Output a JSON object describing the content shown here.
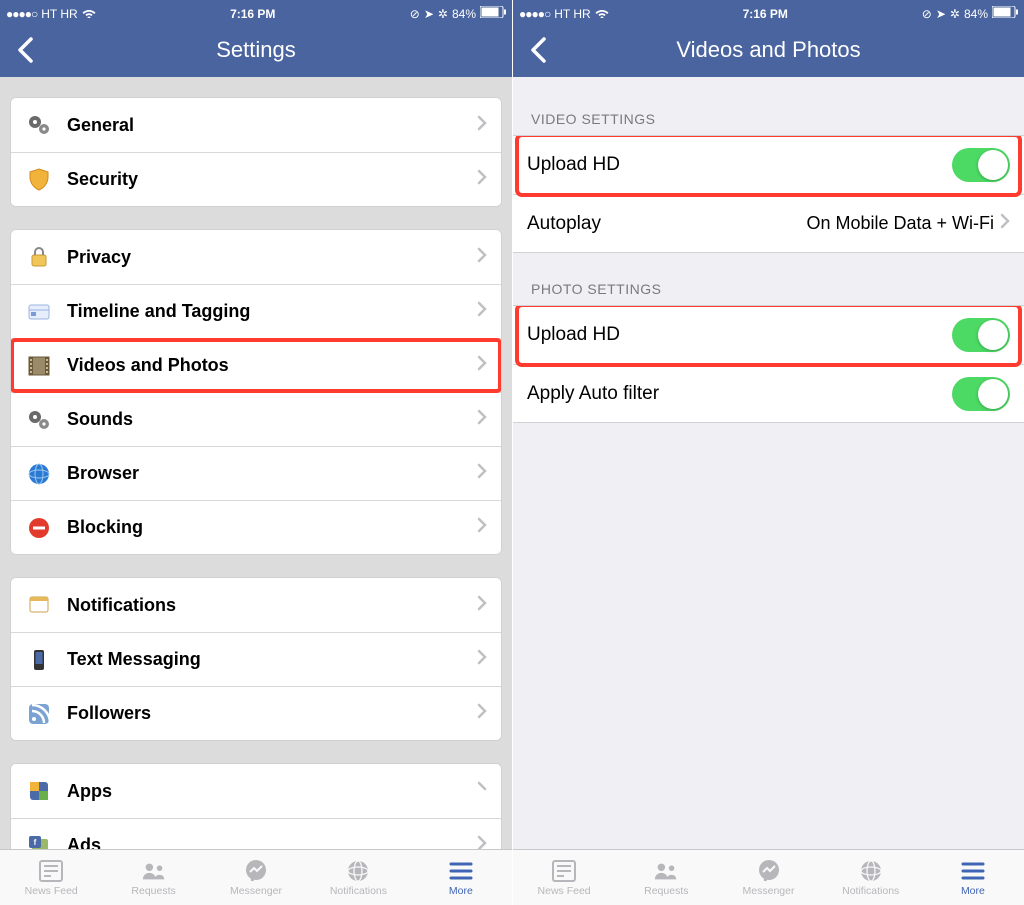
{
  "statusbar": {
    "carrier": "HT HR",
    "time": "7:16 PM",
    "battery": "84%"
  },
  "left": {
    "title": "Settings",
    "groups": [
      [
        {
          "label": "General",
          "icon": "gears"
        },
        {
          "label": "Security",
          "icon": "shield"
        }
      ],
      [
        {
          "label": "Privacy",
          "icon": "lock"
        },
        {
          "label": "Timeline and Tagging",
          "icon": "timeline"
        },
        {
          "label": "Videos and Photos",
          "icon": "film",
          "highlight": true
        },
        {
          "label": "Sounds",
          "icon": "gears"
        },
        {
          "label": "Browser",
          "icon": "globe"
        },
        {
          "label": "Blocking",
          "icon": "blocked"
        }
      ],
      [
        {
          "label": "Notifications",
          "icon": "note"
        },
        {
          "label": "Text Messaging",
          "icon": "phone"
        },
        {
          "label": "Followers",
          "icon": "rss"
        }
      ],
      [
        {
          "label": "Apps",
          "icon": "apps"
        },
        {
          "label": "Ads",
          "icon": "ads"
        }
      ]
    ]
  },
  "right": {
    "title": "Videos and Photos",
    "video_section": "VIDEO SETTINGS",
    "photo_section": "PHOTO SETTINGS",
    "video_upload_hd": "Upload HD",
    "autoplay_label": "Autoplay",
    "autoplay_value": "On Mobile Data + Wi-Fi",
    "photo_upload_hd": "Upload HD",
    "auto_filter": "Apply Auto filter"
  },
  "tabs": {
    "newsfeed": "News Feed",
    "requests": "Requests",
    "messenger": "Messenger",
    "notifications": "Notifications",
    "more": "More"
  }
}
